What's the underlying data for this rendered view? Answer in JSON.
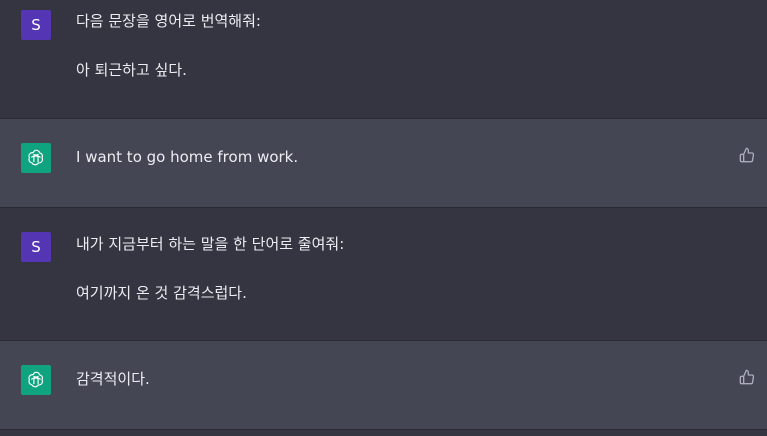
{
  "messages": [
    {
      "role": "user",
      "avatar_letter": "S",
      "lines": [
        "다음 문장을 영어로 번역해줘:",
        "아 퇴근하고 싶다."
      ]
    },
    {
      "role": "assistant",
      "avatar_icon": "openai-logo-icon",
      "lines": [
        "I want to go home from work."
      ],
      "feedback_icon": "thumbs-up-icon"
    },
    {
      "role": "user",
      "avatar_letter": "S",
      "lines": [
        "내가 지금부터 하는 말을 한 단어로 줄여줘:",
        "여기까지 온 것 감격스럽다."
      ]
    },
    {
      "role": "assistant",
      "avatar_icon": "openai-logo-icon",
      "lines": [
        "감격적이다."
      ],
      "feedback_icon": "thumbs-up-icon"
    }
  ],
  "colors": {
    "user_bg": "#343541",
    "assistant_bg": "#444654",
    "user_avatar": "#5436b4",
    "assistant_avatar": "#10a37f",
    "text": "#ececf1"
  }
}
